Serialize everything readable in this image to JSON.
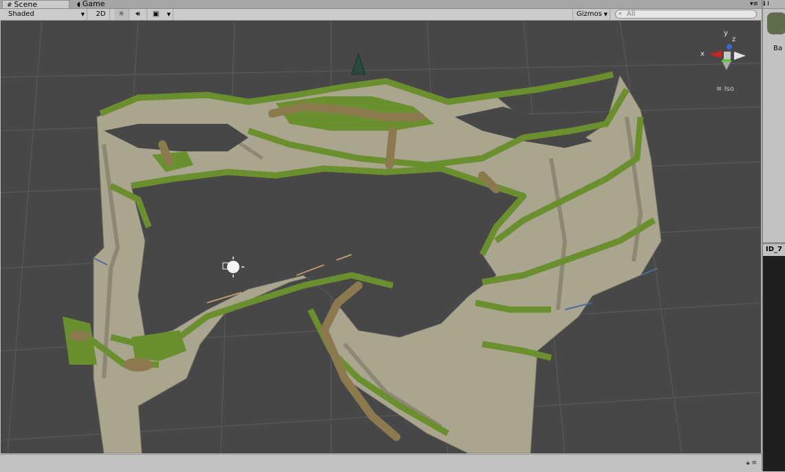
{
  "tabs": [
    {
      "label": "Scene",
      "icon": "grid-icon"
    },
    {
      "label": "Game",
      "icon": "pacman-icon"
    }
  ],
  "toolbar": {
    "shading_mode": "Shaded",
    "mode_2d": "2D",
    "gizmos_label": "Gizmos",
    "search_placeholder": "All"
  },
  "gizmo": {
    "x_label": "x",
    "y_label": "y",
    "z_label": "z",
    "projection": "Iso"
  },
  "inspector": {
    "header": "I",
    "label": "Ba",
    "second_panel_label": "ID_7"
  },
  "colors": {
    "viewport_bg": "#474747",
    "grid_line": "#5c5c5c",
    "grass": "#6a8f2d",
    "cliff": "#a9a58e",
    "path": "#8a7a4e"
  }
}
